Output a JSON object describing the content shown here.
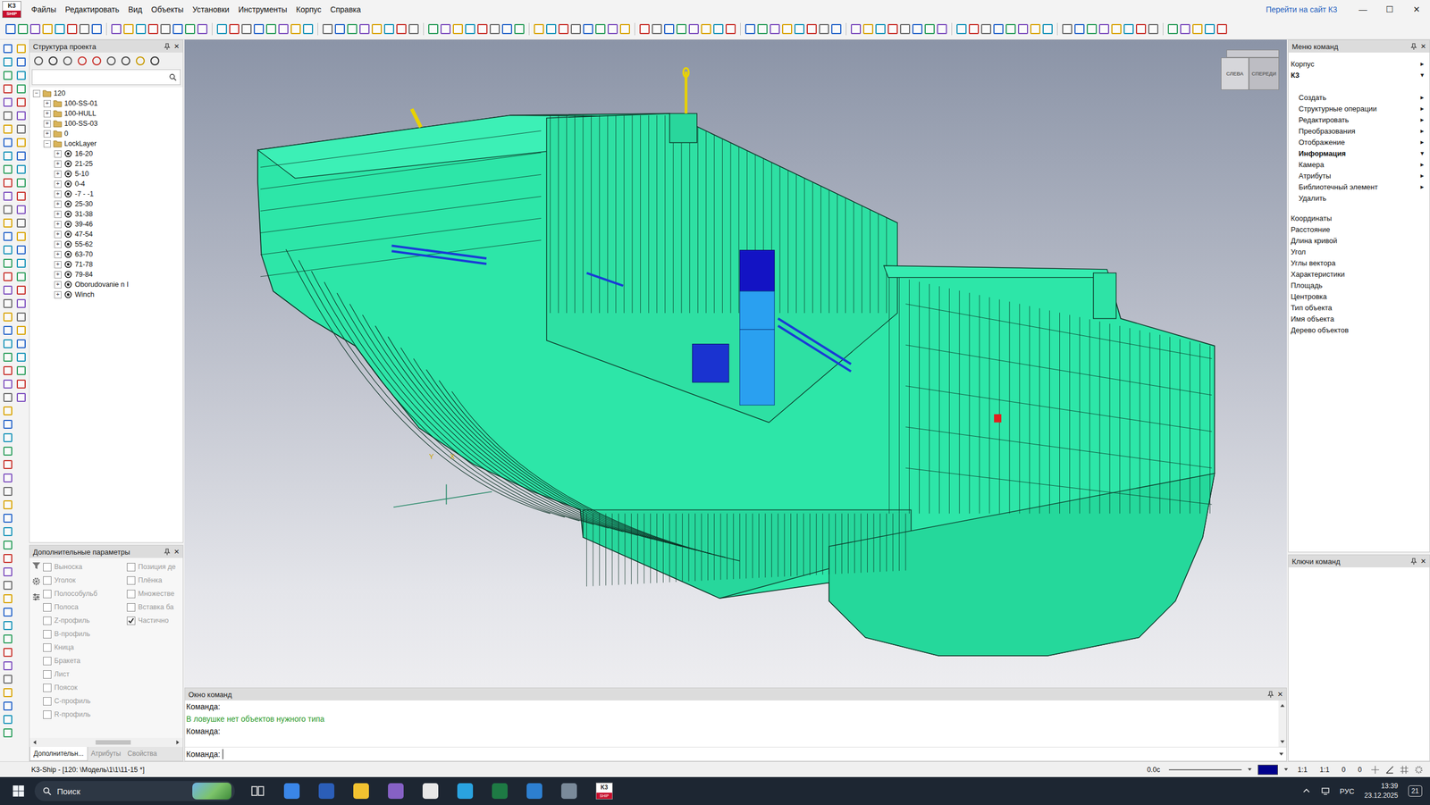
{
  "window": {
    "logo_top": "K3",
    "logo_bottom": "SHIP",
    "site_link": "Перейти на сайт К3",
    "controls": [
      "—",
      "☐",
      "✕"
    ]
  },
  "menu": [
    "Файлы",
    "Редактировать",
    "Вид",
    "Объекты",
    "Установки",
    "Инструменты",
    "Корпус",
    "Справка"
  ],
  "panel_close": "✕",
  "project_panel": {
    "title": "Структура проекта",
    "search_value": "",
    "expander": {
      "open": "−",
      "closed": "+"
    },
    "tree": [
      {
        "label": "120",
        "level": 0,
        "expanded": true,
        "kind": "folder"
      },
      {
        "label": "100-SS-01",
        "level": 1,
        "expanded": false,
        "kind": "folder"
      },
      {
        "label": "100-HULL",
        "level": 1,
        "expanded": false,
        "kind": "folder"
      },
      {
        "label": "100-SS-03",
        "level": 1,
        "expanded": false,
        "kind": "folder"
      },
      {
        "label": "0",
        "level": 1,
        "expanded": false,
        "kind": "folder"
      },
      {
        "label": "LockLayer",
        "level": 1,
        "expanded": true,
        "kind": "folder"
      },
      {
        "label": "16-20",
        "level": 2,
        "expanded": false,
        "kind": "layer"
      },
      {
        "label": "21-25",
        "level": 2,
        "expanded": false,
        "kind": "layer"
      },
      {
        "label": "5-10",
        "level": 2,
        "expanded": false,
        "kind": "layer"
      },
      {
        "label": "0-4",
        "level": 2,
        "expanded": false,
        "kind": "layer"
      },
      {
        "label": "-7 - -1",
        "level": 2,
        "expanded": false,
        "kind": "layer"
      },
      {
        "label": "25-30",
        "level": 2,
        "expanded": false,
        "kind": "layer"
      },
      {
        "label": "31-38",
        "level": 2,
        "expanded": false,
        "kind": "layer"
      },
      {
        "label": "39-46",
        "level": 2,
        "expanded": false,
        "kind": "layer"
      },
      {
        "label": "47-54",
        "level": 2,
        "expanded": false,
        "kind": "layer"
      },
      {
        "label": "55-62",
        "level": 2,
        "expanded": false,
        "kind": "layer"
      },
      {
        "label": "63-70",
        "level": 2,
        "expanded": false,
        "kind": "layer"
      },
      {
        "label": "71-78",
        "level": 2,
        "expanded": false,
        "kind": "layer"
      },
      {
        "label": "79-84",
        "level": 2,
        "expanded": false,
        "kind": "layer"
      },
      {
        "label": "Oborudovanie n I",
        "level": 2,
        "expanded": false,
        "kind": "layer"
      },
      {
        "label": "Winch",
        "level": 2,
        "expanded": false,
        "kind": "layer"
      }
    ]
  },
  "params_panel": {
    "title": "Дополнительные параметры",
    "left": [
      {
        "label": "Выноска",
        "checked": false,
        "disabled": true
      },
      {
        "label": "Уголок",
        "checked": false,
        "disabled": true
      },
      {
        "label": "Полособульб",
        "checked": false,
        "disabled": true
      },
      {
        "label": "Полоса",
        "checked": false,
        "disabled": true
      },
      {
        "label": "Z-профиль",
        "checked": false,
        "disabled": true
      },
      {
        "label": "В-профиль",
        "checked": false,
        "disabled": true
      },
      {
        "label": "Кница",
        "checked": false,
        "disabled": true
      },
      {
        "label": "Бракета",
        "checked": false,
        "disabled": true
      },
      {
        "label": "Лист",
        "checked": false,
        "disabled": true
      },
      {
        "label": "Поясок",
        "checked": false,
        "disabled": true
      },
      {
        "label": "С-профиль",
        "checked": false,
        "disabled": true
      },
      {
        "label": "R-профиль",
        "checked": false,
        "disabled": true
      }
    ],
    "right": [
      {
        "label": "Позиция де",
        "checked": false,
        "disabled": true
      },
      {
        "label": "Плёнка",
        "checked": false,
        "disabled": true
      },
      {
        "label": "Множестве",
        "checked": false,
        "disabled": true
      },
      {
        "label": "Вставка ба",
        "checked": false,
        "disabled": true
      },
      {
        "label": "Частично",
        "checked": true,
        "disabled": true
      }
    ],
    "tabs": [
      {
        "label": "Дополнительн...",
        "selected": true
      },
      {
        "label": "Атрибуты",
        "selected": false
      },
      {
        "label": "Свойства",
        "selected": false
      }
    ]
  },
  "viewport": {
    "cube": {
      "left": "СЛЕВА",
      "front": "СПЕРЕДИ"
    },
    "axes": {
      "y": "Y",
      "x": "X"
    }
  },
  "command_window": {
    "title": "Окно команд",
    "lines": [
      {
        "text": "Команда:",
        "kind": "prompt"
      },
      {
        "text": "В ловушке нет объектов нужного типа",
        "kind": "message"
      },
      {
        "text": "Команда:",
        "kind": "prompt"
      }
    ],
    "input_prompt": "Команда:",
    "input_value": ""
  },
  "command_menu": {
    "title": "Меню команд",
    "category": "Корпус",
    "category_arrow": "▸",
    "module": "К3",
    "module_arrow": "▾",
    "sections": [
      {
        "label": "Создать",
        "selected": false,
        "expanded": false,
        "arrow": "▸"
      },
      {
        "label": "Структурные операции",
        "selected": false,
        "expanded": false,
        "arrow": "▸"
      },
      {
        "label": "Редактировать",
        "selected": false,
        "expanded": false,
        "arrow": "▸"
      },
      {
        "label": "Преобразования",
        "selected": false,
        "expanded": false,
        "arrow": "▸"
      },
      {
        "label": "Отображение",
        "selected": false,
        "expanded": false,
        "arrow": "▸"
      },
      {
        "label": "Информация",
        "selected": true,
        "expanded": true,
        "arrow": "▾"
      },
      {
        "label": "Камера",
        "selected": false,
        "expanded": false,
        "arrow": "▸"
      },
      {
        "label": "Атрибуты",
        "selected": false,
        "expanded": false,
        "arrow": "▸"
      },
      {
        "label": "Библиотечный элемент",
        "selected": false,
        "expanded": false,
        "arrow": "▸"
      },
      {
        "label": "Удалить",
        "selected": false,
        "expanded": false,
        "arrow": ""
      }
    ],
    "info_items": [
      "Координаты",
      "Расстояние",
      "Длина кривой",
      "Угол",
      "Углы вектора",
      "Характеристики",
      "Площадь",
      "Центровка",
      "Тип объекта",
      "Имя объекта",
      "Дерево объектов"
    ]
  },
  "keys_panel": {
    "title": "Ключи команд"
  },
  "status_bar": {
    "text": "K3-Ship - [120: \\Модель\\1\\1\\11-15 *]",
    "time": "0.0с",
    "current_color": "#00008b",
    "scale1": "1:1",
    "scale2": "1:1",
    "x": "0",
    "y": "0"
  },
  "taskbar": {
    "search": "Поиск",
    "language": "РУС",
    "time": "13:39",
    "date": "23.12.2025",
    "notifications": "21"
  }
}
